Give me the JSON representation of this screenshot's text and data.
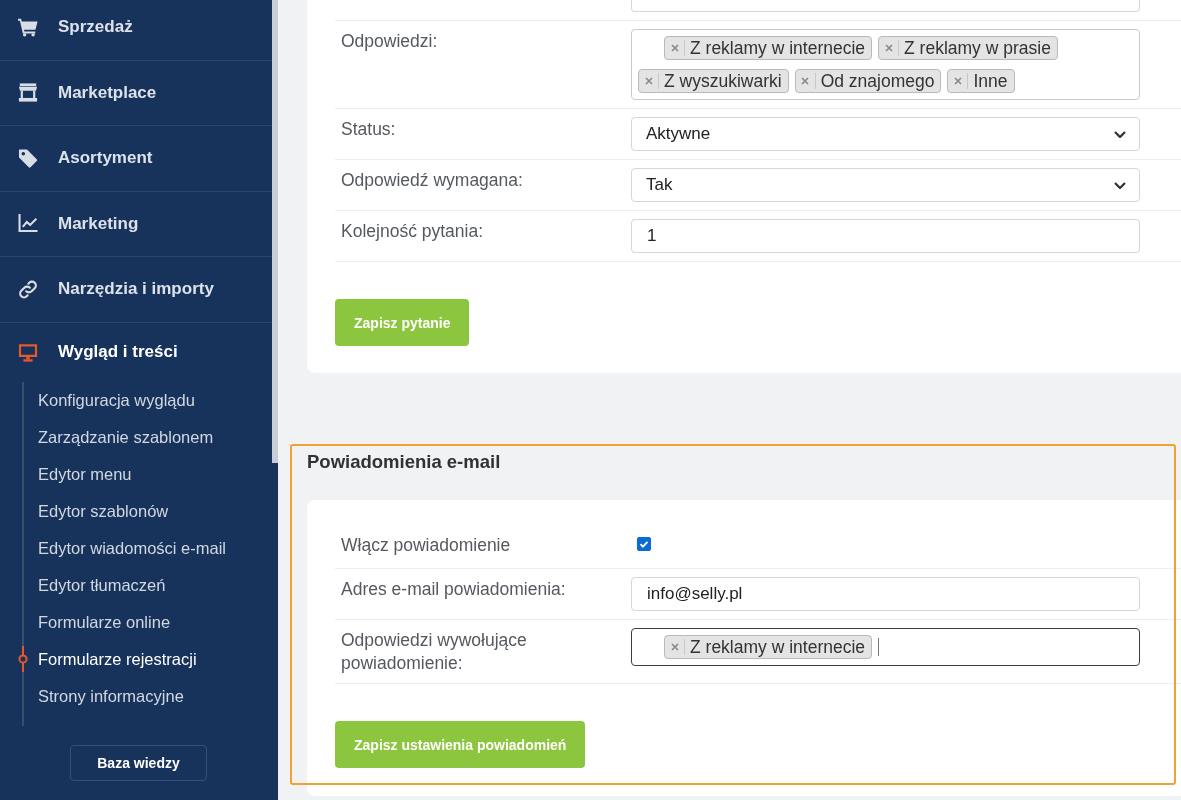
{
  "sidebar": {
    "items": [
      {
        "label": "Sprzedaż",
        "selected": false
      },
      {
        "label": "Marketplace",
        "selected": false
      },
      {
        "label": "Asortyment",
        "selected": false
      },
      {
        "label": "Marketing",
        "selected": false
      },
      {
        "label": "Narzędzia i importy",
        "selected": false
      },
      {
        "label": "Wygląd i treści",
        "selected": true,
        "children": [
          {
            "label": "Konfiguracja wyglądu",
            "selected": false
          },
          {
            "label": "Zarządzanie szablonem",
            "selected": false
          },
          {
            "label": "Edytor menu",
            "selected": false
          },
          {
            "label": "Edytor szablonów",
            "selected": false
          },
          {
            "label": "Edytor wiadomości e-mail",
            "selected": false
          },
          {
            "label": "Edytor tłumaczeń",
            "selected": false
          },
          {
            "label": "Formularze online",
            "selected": false
          },
          {
            "label": "Formularze rejestracji",
            "selected": true
          },
          {
            "label": "Strony informacyjne",
            "selected": false
          }
        ]
      }
    ],
    "help_button": "Baza wiedzy"
  },
  "question_form": {
    "rows": [
      {
        "kind": "cut"
      },
      {
        "kind": "tags",
        "label": "Odpowiedzi:",
        "tags": [
          "Z reklamy w internecie",
          "Z reklamy w prasie",
          "Z wyszukiwarki",
          "Od znajomego",
          "Inne"
        ],
        "focused": false
      },
      {
        "kind": "select",
        "label": "Status:",
        "value": "Aktywne"
      },
      {
        "kind": "select",
        "label": "Odpowiedź wymagana:",
        "value": "Tak"
      },
      {
        "kind": "text",
        "label": "Kolejność pytania:",
        "value": "1"
      }
    ],
    "button": "Zapisz pytanie"
  },
  "notifications": {
    "title": "Powiadomienia e-mail",
    "highlighted": true,
    "rows": [
      {
        "kind": "checkbox",
        "label": "Włącz powiadomienie",
        "checked": true
      },
      {
        "kind": "text",
        "label": "Adres e-mail powiadomienia:",
        "value": "info@selly.pl"
      },
      {
        "kind": "tags",
        "label": "Odpowiedzi wywołujące powiadomienie:",
        "tags": [
          "Z reklamy w internecie"
        ],
        "focused": true
      }
    ],
    "button": "Zapisz ustawienia powiadomień"
  }
}
